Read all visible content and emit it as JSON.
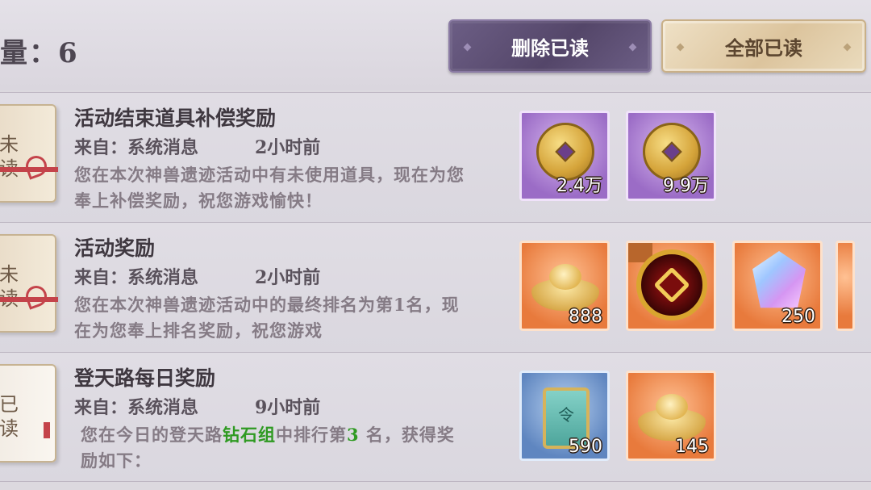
{
  "header": {
    "count_label": "量：6",
    "delete_read_label": "删除已读",
    "mark_all_read_label": "全部已读"
  },
  "mails": [
    {
      "status_chars": [
        "未",
        "读"
      ],
      "title": "活动结束道具补偿奖励",
      "from": "来自：系统消息",
      "time": "2小时前",
      "body": "您在本次神兽遗迹活动中有未使用道具，现在为您奉上补偿奖励，祝您游戏愉快！",
      "rewards": [
        {
          "icon": "gold-coin-icon",
          "qty": "2.4万"
        },
        {
          "icon": "gold-coin-icon",
          "qty": "9.9万"
        }
      ]
    },
    {
      "status_chars": [
        "未",
        "读"
      ],
      "title": "活动奖励",
      "from": "来自：系统消息",
      "time": "2小时前",
      "body": "您在本次神兽遗迹活动中的最终排名为第1名，现在为您奉上排名奖励，祝您游戏",
      "rewards": [
        {
          "icon": "gold-ingot-icon",
          "qty": "888"
        },
        {
          "icon": "golden-emblem-icon",
          "qty": ""
        },
        {
          "icon": "crystal-gem-icon",
          "qty": "250"
        }
      ]
    },
    {
      "status_chars": [
        "已",
        "读"
      ],
      "title": "登天路每日奖励",
      "from": "来自：系统消息",
      "time": "9小时前",
      "body_prefix": "您在今日的登天路",
      "body_highlight": "钻石组",
      "body_mid": "中排行第",
      "body_rank": "3",
      "body_suffix": " 名，获得奖励如下：",
      "rewards": [
        {
          "icon": "command-token-icon",
          "qty": "590"
        },
        {
          "icon": "gold-ingot-icon",
          "qty": "145"
        }
      ]
    }
  ],
  "colors": {
    "highlight_green": "#2f9a22",
    "delete_button": "#5c4e73",
    "mark_all_button": "#e3cfaa"
  }
}
